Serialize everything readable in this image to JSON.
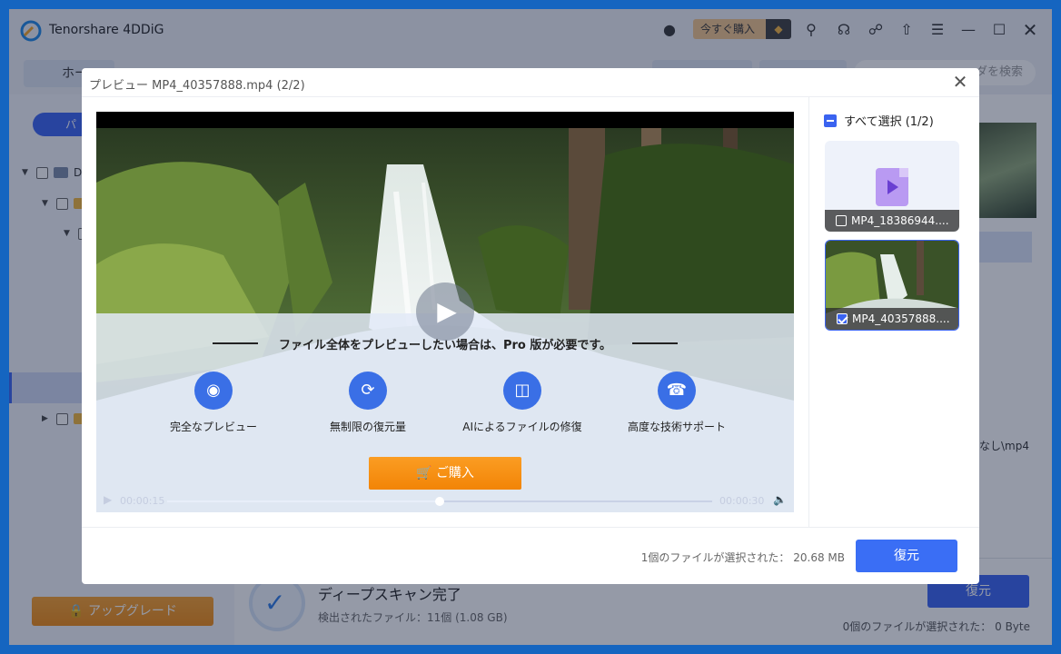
{
  "app": {
    "title": "Tenorshare 4DDiG",
    "buy_now_label": "今すぐ購入",
    "icons": [
      "robot-icon",
      "gem-icon",
      "key-icon",
      "headset-icon",
      "share-icon",
      "upload-icon",
      "menu-icon",
      "minimize-icon",
      "maximize-icon",
      "close-icon"
    ]
  },
  "background": {
    "home_tab": "ホー",
    "search_placeholder": "ダを検索",
    "path_pill": "パ",
    "tree_drive_label": "D",
    "path_text": "なし\\mp4",
    "scan_title": "ディープスキャン完了",
    "scan_sub": "検出されたファイル：11個 (1.08 GB)",
    "restore_label": "復元",
    "selected_text": "0個のファイルが選択された： 0 Byte",
    "upgrade_label": "アップグレード"
  },
  "preview": {
    "title": "プレビュー MP4_40357888.mp4 (2/2)",
    "upsell_heading": "ファイル全体をプレビューしたい場合は、Pro 版が必要です。",
    "features": [
      {
        "label": "完全なプレビュー",
        "icon": "eye-icon"
      },
      {
        "label": "無制限の復元量",
        "icon": "recover-icon"
      },
      {
        "label": "AIによるファイルの修復",
        "icon": "repair-icon"
      },
      {
        "label": "高度な技術サポート",
        "icon": "support-icon"
      }
    ],
    "purchase_label": "ご購入",
    "time_current": "00:00:15",
    "time_total": "00:00:30",
    "progress": 0.5
  },
  "file_list": {
    "select_all_label": "すべて選択 (1/2)",
    "items": [
      {
        "name": "MP4_18386944....",
        "checked": false
      },
      {
        "name": "MP4_40357888....",
        "checked": true
      }
    ]
  },
  "footer": {
    "selected_text": "1個のファイルが選択された： 20.68 MB",
    "restore_label": "復元"
  },
  "colors": {
    "accent": "#3a63f0",
    "purchase": "#f28406",
    "window_border": "#1565c0"
  }
}
